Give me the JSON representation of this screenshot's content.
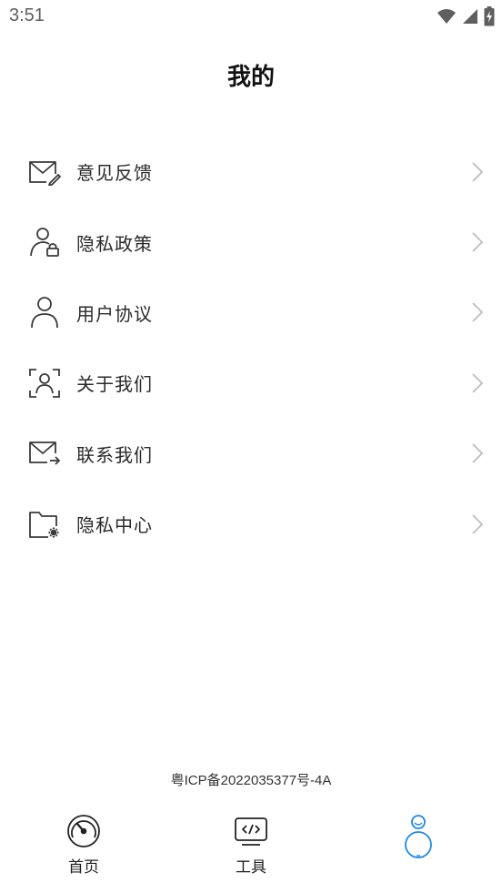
{
  "status_bar": {
    "time": "3:51",
    "icons": [
      "wifi-icon",
      "signal-icon",
      "battery-charging-icon"
    ]
  },
  "page": {
    "title": "我的"
  },
  "menu": {
    "items": [
      {
        "label": "意见反馈",
        "icon": "mail-edit-icon"
      },
      {
        "label": "隐私政策",
        "icon": "user-lock-icon"
      },
      {
        "label": "用户协议",
        "icon": "user-icon"
      },
      {
        "label": "关于我们",
        "icon": "user-scan-icon"
      },
      {
        "label": "联系我们",
        "icon": "mail-forward-icon"
      },
      {
        "label": "隐私中心",
        "icon": "folder-settings-icon"
      }
    ]
  },
  "footer": {
    "icp": "粤ICP备2022035377号-4A"
  },
  "tabbar": {
    "tabs": [
      {
        "label": "首页",
        "icon": "speedometer-icon",
        "active": false
      },
      {
        "label": "工具",
        "icon": "code-window-icon",
        "active": false
      },
      {
        "label": "",
        "icon": "profile-active-icon",
        "active": true
      }
    ]
  },
  "colors": {
    "text": "#2a2a2a",
    "icon": "#3a3a3a",
    "chevron": "#bdbdbd",
    "active_tab": "#1e88e5",
    "status": "#5f5f5f"
  }
}
